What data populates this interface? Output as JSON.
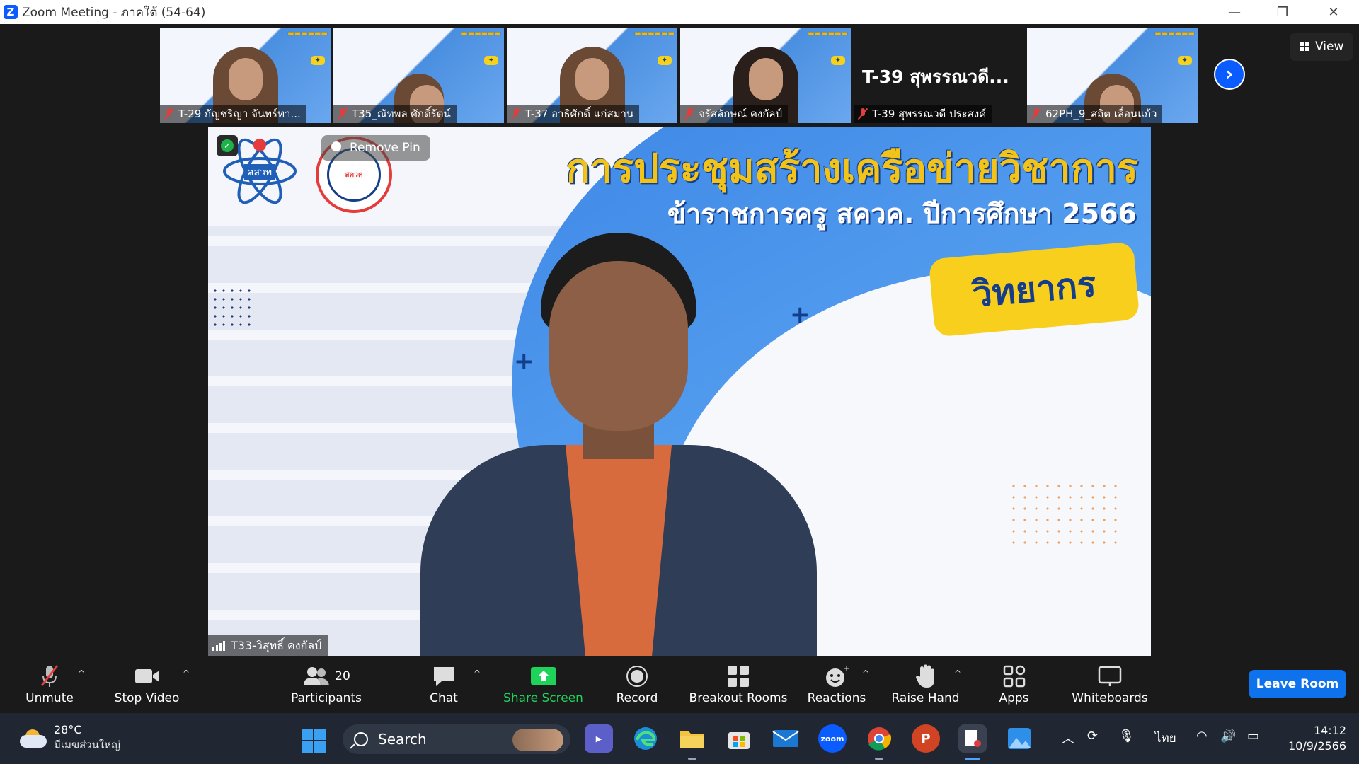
{
  "window": {
    "title": "Zoom Meeting - ภาคใต้ (54-64)"
  },
  "thumbnails": [
    {
      "name": "T-29 กัญชริญา  จันทร์ทา...",
      "muted": true
    },
    {
      "name": "T35_ณัทพล ศักดิ์รัตน์",
      "muted": true
    },
    {
      "name": "T-37 อาธิศักดิ์ แก่สมาน",
      "muted": true
    },
    {
      "name": "จรัสลักษณ์ คงกัลป์",
      "muted": true
    },
    {
      "name": "T-39 สุพรรณวดี ประสงค์",
      "muted": true,
      "video_off_label": "T-39 สุพรรณวดี..."
    },
    {
      "name": "62PH_9_สถิต เลื่อนแก้ว",
      "muted": true
    }
  ],
  "strip_controls": {
    "view_label": "View"
  },
  "main_video": {
    "title": "การประชุมสร้างเครือข่ายวิชาการ",
    "subtitle": "ข้าราชการครู สควค. ปีการศึกษา 2566",
    "tag": "วิทยากร",
    "logo1_text": "สสวท",
    "logo2_text": "สควค",
    "pin_label": "Remove Pin",
    "speaker_name": "T33-วิสุทธิ์ คงกัลป์"
  },
  "controls": {
    "unmute": "Unmute",
    "stop_video": "Stop Video",
    "participants": "Participants",
    "participants_count": "20",
    "chat": "Chat",
    "share_screen": "Share Screen",
    "record": "Record",
    "breakout_rooms": "Breakout Rooms",
    "reactions": "Reactions",
    "raise_hand": "Raise Hand",
    "apps": "Apps",
    "whiteboards": "Whiteboards",
    "leave": "Leave Room"
  },
  "taskbar": {
    "temperature": "28°C",
    "weather_desc": "มีเมฆส่วนใหญ่",
    "search_label": "Search",
    "language": "ไทย",
    "time": "14:12",
    "date": "10/9/2566",
    "zoom_app_label": "zoom",
    "powerpoint_label": "P"
  },
  "colors": {
    "accent": "#0b5cff",
    "leave": "#0e72ed",
    "share_green": "#1fd35a",
    "muted_red": "#e03e3e",
    "slide_yellow": "#f3c318",
    "slide_blue": "#3d86e6"
  }
}
